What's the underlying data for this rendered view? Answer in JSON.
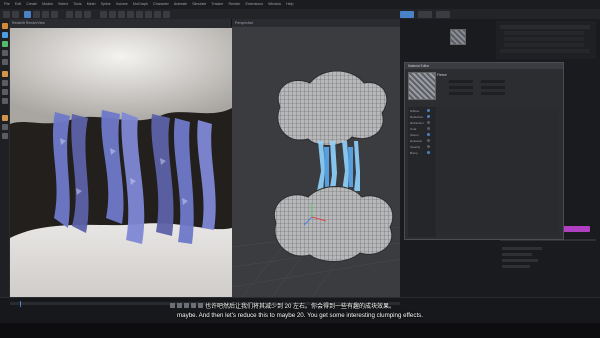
{
  "menubar": {
    "items": [
      "File",
      "Edit",
      "Create",
      "Modes",
      "Select",
      "Tools",
      "Mesh",
      "Spline",
      "Volume",
      "MoGraph",
      "Character",
      "Animate",
      "Simulate",
      "Tracker",
      "Render",
      "Extensions",
      "Window",
      "Help"
    ]
  },
  "render_view": {
    "title": "Redshift RenderView"
  },
  "viewport": {
    "title": "Perspective"
  },
  "material_window": {
    "title": "Material Editor",
    "section": "Fleece",
    "tree_items": [
      "Diffuse",
      "Reflection",
      "Refraction",
      "Coat",
      "Sheen",
      "Emission",
      "Opacity",
      "Bump"
    ]
  },
  "subtitles": {
    "chinese": "也许吧然后让我们将其减少到 20 左右。你会得到一些有趣的成块效果。",
    "english": "maybe. And then let's reduce this to maybe 20. You get some interesting clumping effects."
  },
  "colors": {
    "selection_accent": "#b13fc2",
    "active_tab": "#4a82c7",
    "hair": "#6e79c9",
    "hair_highlight": "#8fd3ff"
  }
}
